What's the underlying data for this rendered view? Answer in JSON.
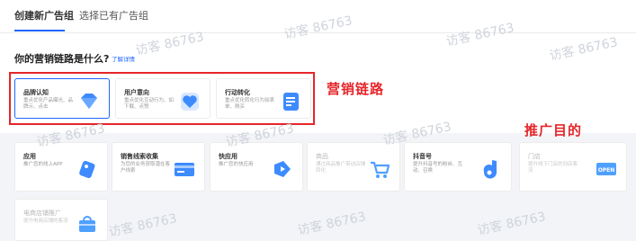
{
  "tabs": {
    "active": "创建新广告组",
    "inactive": "选择已有广告组"
  },
  "question": "你的营销链路是什么?",
  "detail_link": "了解详情",
  "marketing_cards": [
    {
      "title": "品牌认知",
      "desc": "重点优化产品曝光、品牌示、点击",
      "icon": "diamond-icon"
    },
    {
      "title": "用户意向",
      "desc": "重点优化互动行为、如下载、点赞",
      "icon": "heart-icon"
    },
    {
      "title": "行动转化",
      "desc": "重点优化转化行为如表单、购买",
      "icon": "form-icon"
    }
  ],
  "goal_cards": [
    {
      "title": "应用",
      "desc": "推广您的线上APP",
      "icon": "app-tag-icon",
      "disabled": false
    },
    {
      "title": "销售线索收集",
      "desc": "为您的业务获取潜在客户线索",
      "icon": "form-card-icon",
      "disabled": false
    },
    {
      "title": "快应用",
      "desc": "推广您的快应用",
      "icon": "quick-app-icon",
      "disabled": false
    },
    {
      "title": "商品",
      "desc": "通过商品推广带动店铺转化",
      "icon": "cart-icon",
      "disabled": true
    },
    {
      "title": "抖音号",
      "desc": "提升抖音号的粉丝、互动、召唤",
      "icon": "douyin-icon",
      "disabled": false
    },
    {
      "title": "门店",
      "desc": "提升线下门店的到店客流",
      "icon": "store-icon",
      "disabled": true
    },
    {
      "title": "电商店铺推广",
      "desc": "提升电商店铺的客流",
      "icon": "shop-icon",
      "disabled": true
    }
  ],
  "annotations": {
    "marketing_chain": "营销链路",
    "promotion_goal": "推广目的"
  },
  "watermark": "访客 86763",
  "colors": {
    "accent": "#1f66ff",
    "annotation": "#e5252a"
  }
}
